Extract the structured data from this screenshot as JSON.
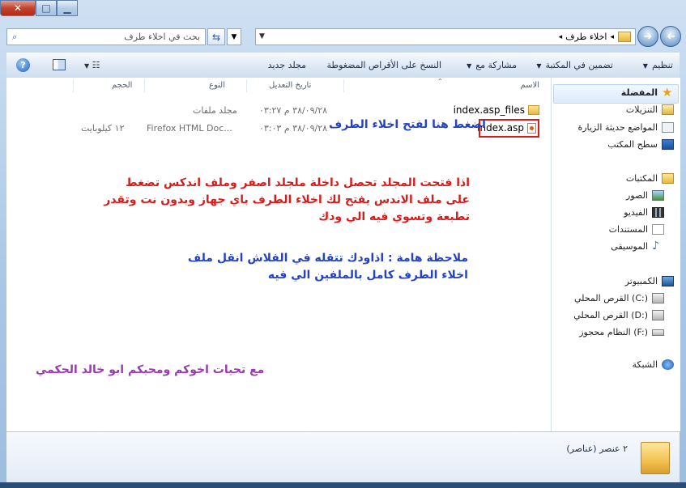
{
  "window": {
    "close_glyph": "✕",
    "max_glyph": "□",
    "min_glyph": "▁"
  },
  "address": {
    "breadcrumb": [
      "اخلاء طرف"
    ],
    "separator": "◂",
    "search_placeholder": "بحث في اخلاء طرف"
  },
  "toolbar": {
    "organize": "تنظيم",
    "include": "تضمين في المكتبة",
    "share": "مشاركة مع",
    "burn": "النسخ على الأقراص المضغوطة",
    "new_folder": "مجلد جديد"
  },
  "columns": {
    "name": "الاسم",
    "modified": "تاريخ التعديل",
    "type": "النوع",
    "size": "الحجم"
  },
  "files": [
    {
      "name": "index.asp_files",
      "modified": "٣٨/٠٩/٢٨ م ٠٣:٢٧",
      "type": "مجلد ملفات",
      "size": ""
    },
    {
      "name": "index.asp",
      "modified": "٣٨/٠٩/٢٨ م ٠٣:٠٣",
      "type": "Firefox HTML Doc...",
      "size": "١٢ كيلوبايت"
    }
  ],
  "notes": {
    "click_here": "اضغط هنا لفتح اخلاء الطرف",
    "instructions": "اذا فتحت المجلد تحصل داخلة ملجلد اصفر وملف اندكس تضغط على ملف الاندس يفتح لك اخلاء الطرف باي جهاز وبدون نت وتقدر تطبعة وتسوي فيه الي ودك",
    "important": "ملاحظة هامة : اذاودك تتقله في الفلاش انقل ملف اخلاء الطرف كامل بالملفين الي فيه",
    "signature": "مع تحيات اخوكم ومحبكم ابو خالد الحكمي"
  },
  "nav": {
    "favorites": "المفضلة",
    "downloads": "التنزيلات",
    "recent": "المواضع حديثة الزيارة",
    "desktop": "سطح المكتب",
    "libraries": "المكتبات",
    "pictures": "الصور",
    "videos": "الفيديو",
    "documents": "المستندات",
    "music": "الموسيقى",
    "computer": "الكمبيوتر",
    "disk_c": "القرص المحلي (C:)",
    "disk_d": "القرص المحلي (D:)",
    "disk_f": "النظام محجوز (F:)",
    "network": "الشبكة"
  },
  "details": {
    "count": "٢ عنصر (عناصر)"
  },
  "colors": {
    "red_note": "#d81c1c",
    "blue_note": "#2442c6",
    "purple_note": "#9b3ab0"
  }
}
